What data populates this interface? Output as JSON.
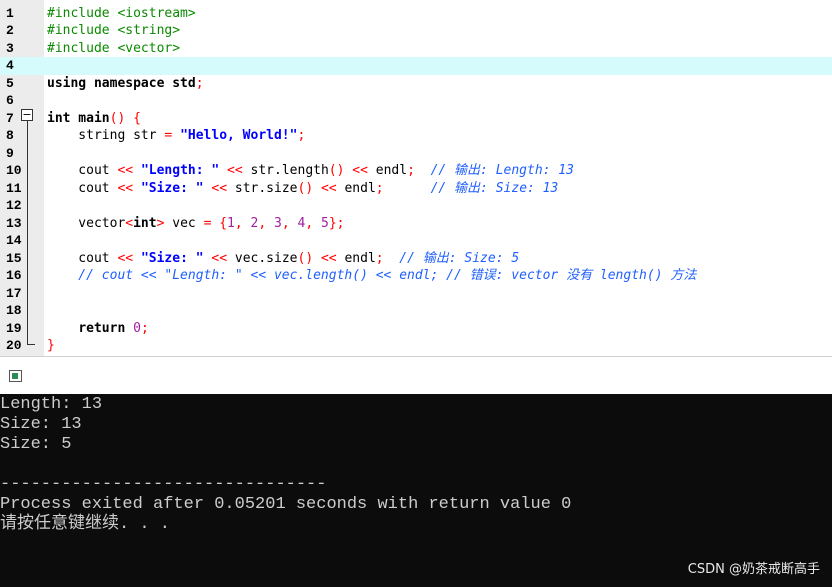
{
  "editor": {
    "line_numbers": [
      "1",
      "2",
      "3",
      "4",
      "5",
      "6",
      "7",
      "8",
      "9",
      "10",
      "11",
      "12",
      "13",
      "14",
      "15",
      "16",
      "17",
      "18",
      "19",
      "20"
    ],
    "fold_marker": "−",
    "lines": [
      [
        {
          "t": "#include <iostream>",
          "c": "pp"
        }
      ],
      [
        {
          "t": "#include <string>",
          "c": "pp"
        }
      ],
      [
        {
          "t": "#include <vector>",
          "c": "pp"
        }
      ],
      [],
      [
        {
          "t": "using namespace std",
          "c": "kw"
        },
        {
          "t": ";",
          "c": "sym"
        }
      ],
      [],
      [
        {
          "t": "int main",
          "c": "kw"
        },
        {
          "t": "() {",
          "c": "sym"
        }
      ],
      [
        {
          "t": "    string str "
        },
        {
          "t": "=",
          "c": "sym"
        },
        {
          "t": " "
        },
        {
          "t": "\"Hello, World!\"",
          "c": "str"
        },
        {
          "t": ";",
          "c": "sym"
        }
      ],
      [],
      [
        {
          "t": "    cout "
        },
        {
          "t": "<<",
          "c": "sym"
        },
        {
          "t": " "
        },
        {
          "t": "\"Length: \"",
          "c": "str"
        },
        {
          "t": " "
        },
        {
          "t": "<<",
          "c": "sym"
        },
        {
          "t": " str.length"
        },
        {
          "t": "()",
          "c": "sym"
        },
        {
          "t": " "
        },
        {
          "t": "<<",
          "c": "sym"
        },
        {
          "t": " endl"
        },
        {
          "t": ";",
          "c": "sym"
        },
        {
          "t": "  "
        },
        {
          "t": "// 输出: Length: 13",
          "c": "cm"
        }
      ],
      [
        {
          "t": "    cout "
        },
        {
          "t": "<<",
          "c": "sym"
        },
        {
          "t": " "
        },
        {
          "t": "\"Size: \"",
          "c": "str"
        },
        {
          "t": " "
        },
        {
          "t": "<<",
          "c": "sym"
        },
        {
          "t": " str.size"
        },
        {
          "t": "()",
          "c": "sym"
        },
        {
          "t": " "
        },
        {
          "t": "<<",
          "c": "sym"
        },
        {
          "t": " endl"
        },
        {
          "t": ";",
          "c": "sym"
        },
        {
          "t": "      "
        },
        {
          "t": "// 输出: Size: 13",
          "c": "cm"
        }
      ],
      [],
      [
        {
          "t": "    vector"
        },
        {
          "t": "<",
          "c": "sym"
        },
        {
          "t": "int",
          "c": "kw"
        },
        {
          "t": ">",
          "c": "sym"
        },
        {
          "t": " vec "
        },
        {
          "t": "=",
          "c": "sym"
        },
        {
          "t": " "
        },
        {
          "t": "{",
          "c": "sym"
        },
        {
          "t": "1",
          "c": "num"
        },
        {
          "t": ", ",
          "c": "sym"
        },
        {
          "t": "2",
          "c": "num"
        },
        {
          "t": ", ",
          "c": "sym"
        },
        {
          "t": "3",
          "c": "num"
        },
        {
          "t": ", ",
          "c": "sym"
        },
        {
          "t": "4",
          "c": "num"
        },
        {
          "t": ", ",
          "c": "sym"
        },
        {
          "t": "5",
          "c": "num"
        },
        {
          "t": "};",
          "c": "sym"
        }
      ],
      [],
      [
        {
          "t": "    cout "
        },
        {
          "t": "<<",
          "c": "sym"
        },
        {
          "t": " "
        },
        {
          "t": "\"Size: \"",
          "c": "str"
        },
        {
          "t": " "
        },
        {
          "t": "<<",
          "c": "sym"
        },
        {
          "t": " vec.size"
        },
        {
          "t": "()",
          "c": "sym"
        },
        {
          "t": " "
        },
        {
          "t": "<<",
          "c": "sym"
        },
        {
          "t": " endl"
        },
        {
          "t": ";",
          "c": "sym"
        },
        {
          "t": "  "
        },
        {
          "t": "// 输出: Size: 5",
          "c": "cm"
        }
      ],
      [
        {
          "t": "    // cout << \"Length: \" << vec.length() << endl; // 错误: vector 没有 length() 方法",
          "c": "cm"
        }
      ],
      [],
      [],
      [
        {
          "t": "    "
        },
        {
          "t": "return",
          "c": "kw"
        },
        {
          "t": " "
        },
        {
          "t": "0",
          "c": "num"
        },
        {
          "t": ";",
          "c": "sym"
        }
      ],
      [
        {
          "t": "}",
          "c": "sym"
        }
      ]
    ],
    "highlighted_line": 4
  },
  "console": {
    "lines": [
      "Length: 13",
      "Size: 13",
      "Size: 5",
      "",
      "--------------------------------",
      "Process exited after 0.05201 seconds with return value 0",
      "请按任意键继续. . ."
    ],
    "watermark": "CSDN @奶茶戒断高手"
  },
  "colors": {
    "editor_bg": "#ffffff",
    "gutter_bg": "#ececec",
    "highlight_line": "#d6fbfc",
    "preprocessor": "#0a8a00",
    "symbol": "#ff0000",
    "string": "#0000ff",
    "number": "#a020a0",
    "comment": "#1f5fff",
    "console_bg": "#0c0c0c",
    "console_text": "#cccccc"
  }
}
